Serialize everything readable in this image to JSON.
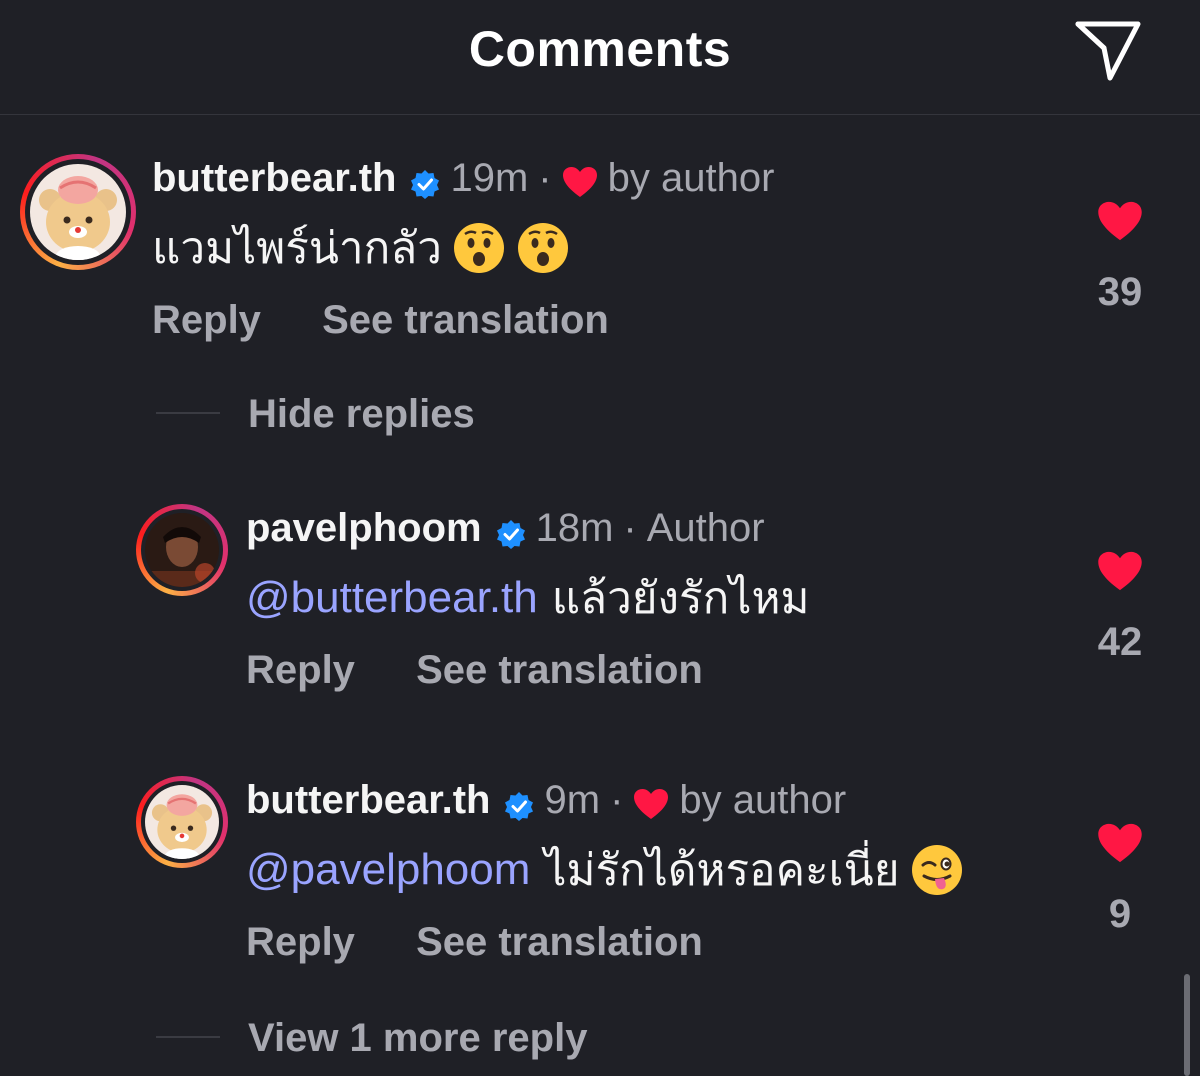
{
  "header": {
    "title": "Comments",
    "share_icon": "paper-plane-icon"
  },
  "colors": {
    "background": "#1f2026",
    "primary_text": "#f5f5f5",
    "secondary_text": "#a8a9b1",
    "mention": "#9aa4ff",
    "like_red": "#ff1744",
    "verified_blue": "#1e90ff"
  },
  "comments": [
    {
      "username": "butterbear.th",
      "verified": true,
      "time": "19m",
      "dot": "·",
      "author_liked": true,
      "tag": "by author",
      "text": "แวมไพร์น่ากลัว",
      "emojis": [
        "astonished-face",
        "astonished-face"
      ],
      "reply_label": "Reply",
      "translate_label": "See translation",
      "likes": "39",
      "avatar": "butterbear-avatar"
    }
  ],
  "hide_replies_label": "Hide replies",
  "replies": [
    {
      "username": "pavelphoom",
      "verified": true,
      "time": "18m",
      "dot": "·",
      "tag": "Author",
      "mention": "@butterbear.th",
      "text": "แล้วยังรักไหม",
      "reply_label": "Reply",
      "translate_label": "See translation",
      "likes": "42",
      "avatar": "pavelphoom-avatar"
    },
    {
      "username": "butterbear.th",
      "verified": true,
      "time": "9m",
      "dot": "·",
      "author_liked": true,
      "tag": "by author",
      "mention": "@pavelphoom",
      "text": "ไม่รักได้หรอคะเนี่ย",
      "emojis": [
        "winking-tongue-face"
      ],
      "reply_label": "Reply",
      "translate_label": "See translation",
      "likes": "9",
      "avatar": "butterbear-avatar"
    }
  ],
  "view_more_label": "View 1 more reply"
}
